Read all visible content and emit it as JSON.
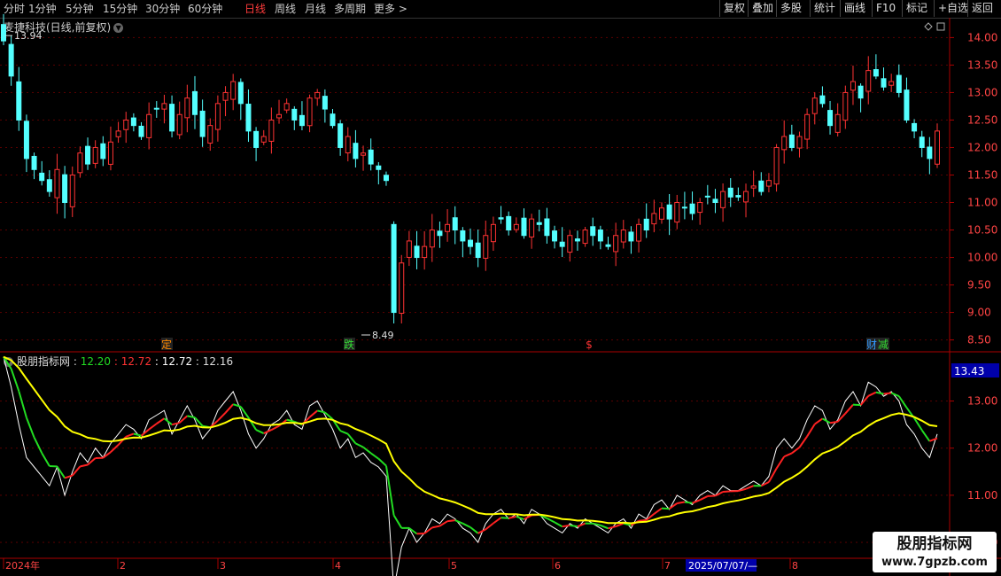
{
  "toolbar": {
    "timeframes": [
      "分时",
      "1分钟",
      "5分钟",
      "15分钟",
      "30分钟",
      "60分钟",
      "日线",
      "周线",
      "月线",
      "多周期",
      "更多 >"
    ],
    "active_timeframe": "日线",
    "buttons": [
      "复权",
      "叠加",
      "多股",
      "统计",
      "画线",
      "F10",
      "标记",
      "+自选",
      "返回"
    ]
  },
  "main_title": "麦捷科技(日线,前复权)",
  "indicator": {
    "name": "股朋指标网",
    "values": [
      {
        "text": "12.20",
        "color": "#22dd22"
      },
      {
        "text": "12.72",
        "color": "#ff3333"
      },
      {
        "text": "12.72",
        "color": "#ffffff"
      },
      {
        "text": "12.16",
        "color": "#dddddd"
      }
    ],
    "axis_value_box": "13.43"
  },
  "markers": {
    "high_label": "13.94",
    "low_label": "8.49",
    "badges": [
      {
        "text": "定",
        "color": "#ff8800"
      },
      {
        "text": "跌",
        "color": "#33dd33"
      },
      {
        "text": "$",
        "color": "#ff3333"
      },
      {
        "text": "财",
        "color": "#3399ff"
      },
      {
        "text": "减",
        "color": "#33dd33"
      }
    ]
  },
  "price_axis": {
    "ticks": [
      "14.00",
      "13.50",
      "13.00",
      "12.50",
      "12.00",
      "11.50",
      "11.00",
      "10.50",
      "10.00",
      "9.50",
      "9.00",
      "8.50"
    ]
  },
  "indicator_axis": {
    "ticks": [
      "13.00",
      "12.00",
      "11.00",
      "10.00"
    ]
  },
  "time_axis": {
    "labels": [
      "2024年",
      "2",
      "3",
      "4",
      "5",
      "6",
      "7",
      "8"
    ],
    "cursor_date": "2025/07/07/—"
  },
  "watermark": {
    "line1": "股朋指标网",
    "line2": "www.7gpzb.com"
  },
  "colors": {
    "up": "#ff3333",
    "down": "#54ffff",
    "axis": "#aa0000",
    "ma_short": "#22dd22",
    "ma_short_up": "#ff2222",
    "ma_long": "#ffff00"
  },
  "chart_data": {
    "type": "candlestick",
    "title": "麦捷科技(日线,前复权)",
    "ylim": [
      8.3,
      14.2
    ],
    "ohlc_sequence_close": [
      13.94,
      13.3,
      12.5,
      11.8,
      11.6,
      11.4,
      11.2,
      11.6,
      11.0,
      11.5,
      11.9,
      11.7,
      12.0,
      11.8,
      12.1,
      12.3,
      12.5,
      12.4,
      12.2,
      12.6,
      12.7,
      12.8,
      12.3,
      12.6,
      12.9,
      12.6,
      12.2,
      12.4,
      12.8,
      13.0,
      13.2,
      12.8,
      12.3,
      12.0,
      12.2,
      12.5,
      12.6,
      12.8,
      12.5,
      12.4,
      12.9,
      13.0,
      12.7,
      12.4,
      12.0,
      12.2,
      11.8,
      11.9,
      11.7,
      11.6,
      11.4,
      9.0,
      9.9,
      10.3,
      10.0,
      10.2,
      10.5,
      10.4,
      10.6,
      10.5,
      10.3,
      10.2,
      10.0,
      10.4,
      10.6,
      10.7,
      10.5,
      10.6,
      10.4,
      10.7,
      10.6,
      10.4,
      10.3,
      10.2,
      10.4,
      10.3,
      10.5,
      10.4,
      10.3,
      10.2,
      10.4,
      10.5,
      10.3,
      10.6,
      10.5,
      10.8,
      10.9,
      10.7,
      11.0,
      10.9,
      10.8,
      11.0,
      11.1,
      11.0,
      11.2,
      11.1,
      11.1,
      11.2,
      11.3,
      11.2,
      11.4,
      12.0,
      12.2,
      12.0,
      12.2,
      12.6,
      12.9,
      12.8,
      12.4,
      12.6,
      13.0,
      13.2,
      12.9,
      13.4,
      13.3,
      13.1,
      13.2,
      13.0,
      12.5,
      12.3,
      12.0,
      11.8,
      12.3
    ]
  }
}
